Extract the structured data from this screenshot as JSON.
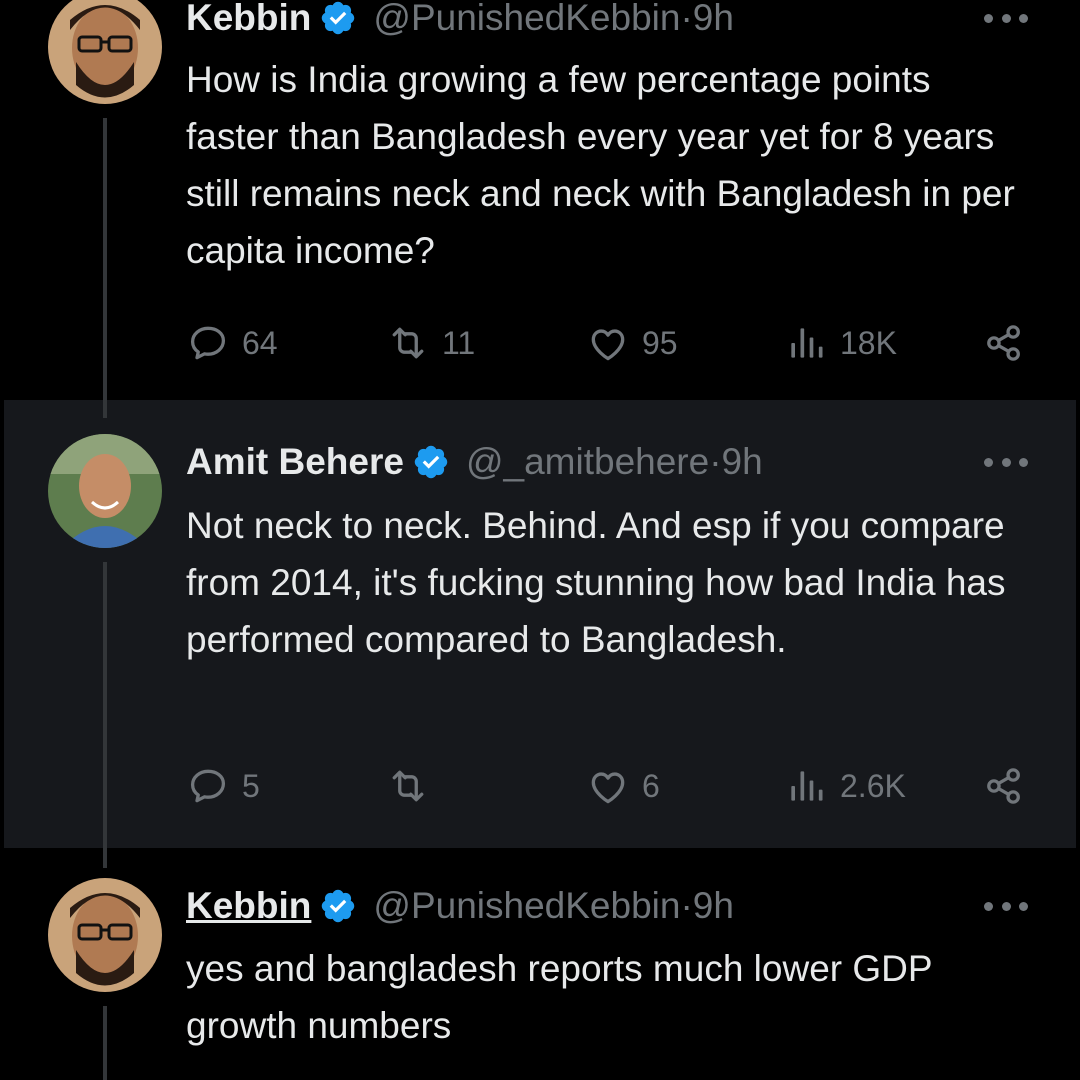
{
  "tweets": [
    {
      "name": "Kebbin",
      "handle": "@PunishedKebbin",
      "time": "9h",
      "text": "How is India growing a few percentage points faster than Bangladesh every year yet for 8 years still remains neck and neck with Bangladesh in per capita income?",
      "replies": "64",
      "retweets": "11",
      "likes": "95",
      "views": "18K"
    },
    {
      "name": "Amit Behere",
      "handle": "@_amitbehere",
      "time": "9h",
      "text": "Not neck to neck. Behind. And esp if you compare from 2014, it's fucking stunning how bad India has performed compared to Bangladesh.",
      "replies": "5",
      "retweets": "",
      "likes": "6",
      "views": "2.6K"
    },
    {
      "name": "Kebbin",
      "handle": "@PunishedKebbin",
      "time": "9h",
      "text": "yes and bangladesh reports much lower GDP growth numbers"
    }
  ],
  "separator": " · ",
  "colors": {
    "verified": "#1d9bf0",
    "muted": "#71767b",
    "text": "#e7e9ea",
    "highlight_bg": "#16181c"
  },
  "icons": [
    "verified-badge-icon",
    "more-icon",
    "reply-icon",
    "retweet-icon",
    "like-icon",
    "views-icon",
    "share-icon"
  ]
}
